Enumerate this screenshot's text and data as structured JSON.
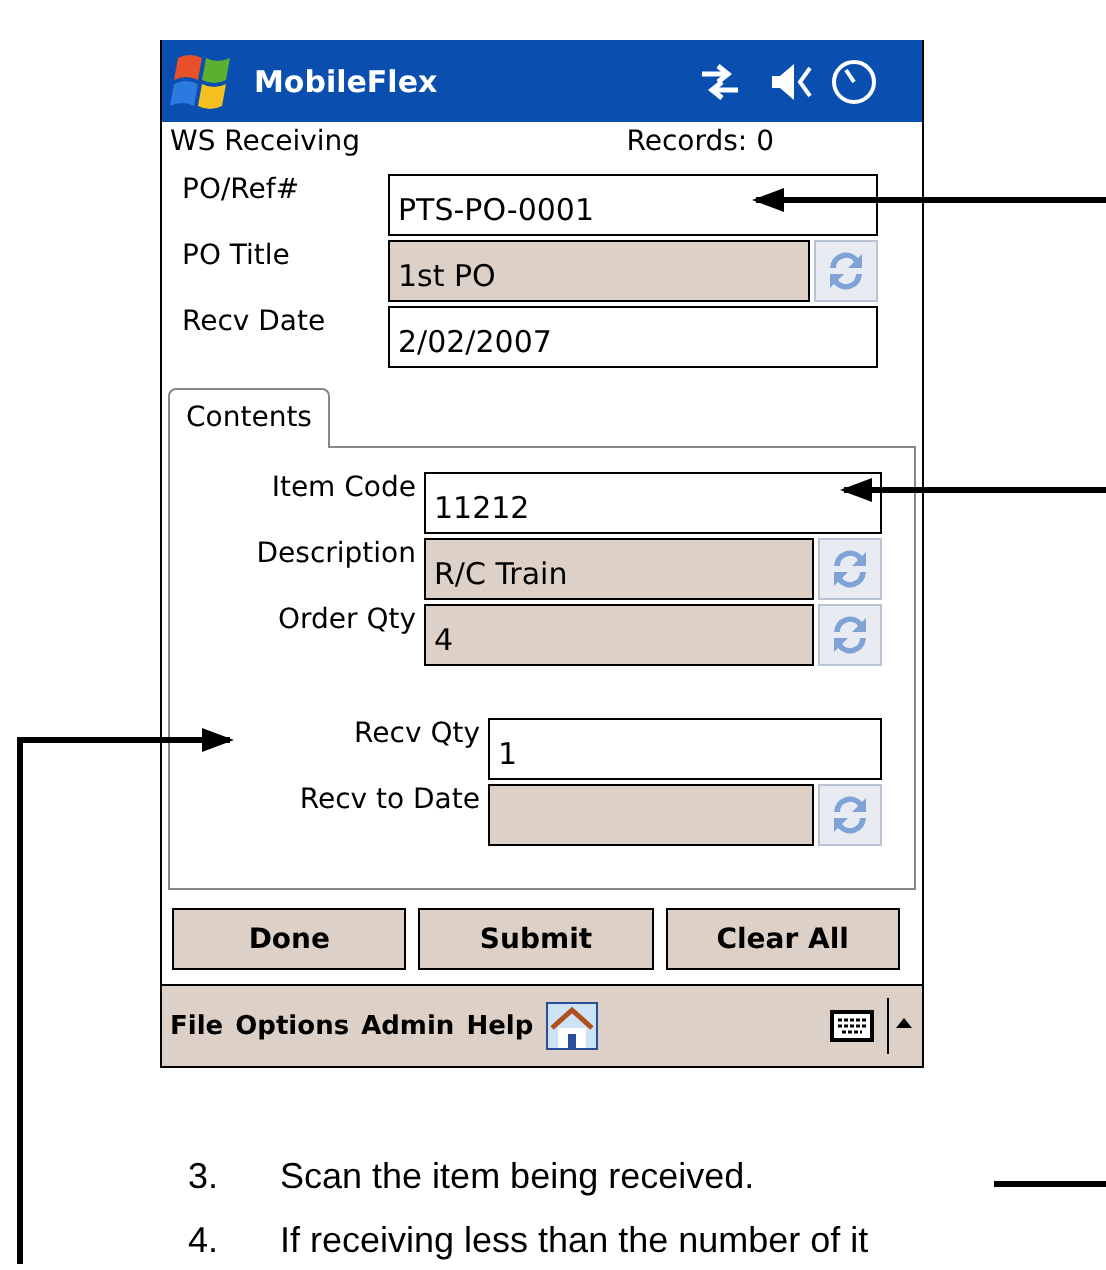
{
  "title_bar": {
    "title": "MobileFlex"
  },
  "header": {
    "form_name": "WS Receiving",
    "records": "Records: 0"
  },
  "fields": [
    {
      "label": "PO/Ref#",
      "value": "PTS-PO-0001",
      "kind": "input"
    },
    {
      "label": "PO Title",
      "value": "1st PO",
      "kind": "lookup"
    },
    {
      "label": "Recv Date",
      "value": "2/02/2007",
      "kind": "input"
    }
  ],
  "tabs": [
    {
      "label": "Contents",
      "selected": true
    }
  ],
  "item_fields": [
    {
      "label": "Item Code",
      "value": "11212",
      "kind": "input"
    },
    {
      "label": "Description",
      "value": "R/C Train",
      "kind": "lookup"
    },
    {
      "label": "Order Qty",
      "value": "4",
      "kind": "lookup"
    }
  ],
  "receipt_fields": [
    {
      "label": "Recv Qty",
      "value": "1",
      "kind": "input"
    },
    {
      "label": "Recv to Date",
      "kind": "lookup"
    }
  ],
  "buttons": [
    "Done",
    "Submit",
    "Clear All"
  ],
  "menu_bar": {
    "items": [
      "File",
      "Options",
      "Admin",
      "Help"
    ]
  },
  "instructions": [
    {
      "number": "3.",
      "text": "Scan the item being received."
    },
    {
      "number": "4.",
      "text": "If receiving less than the number of it"
    }
  ]
}
